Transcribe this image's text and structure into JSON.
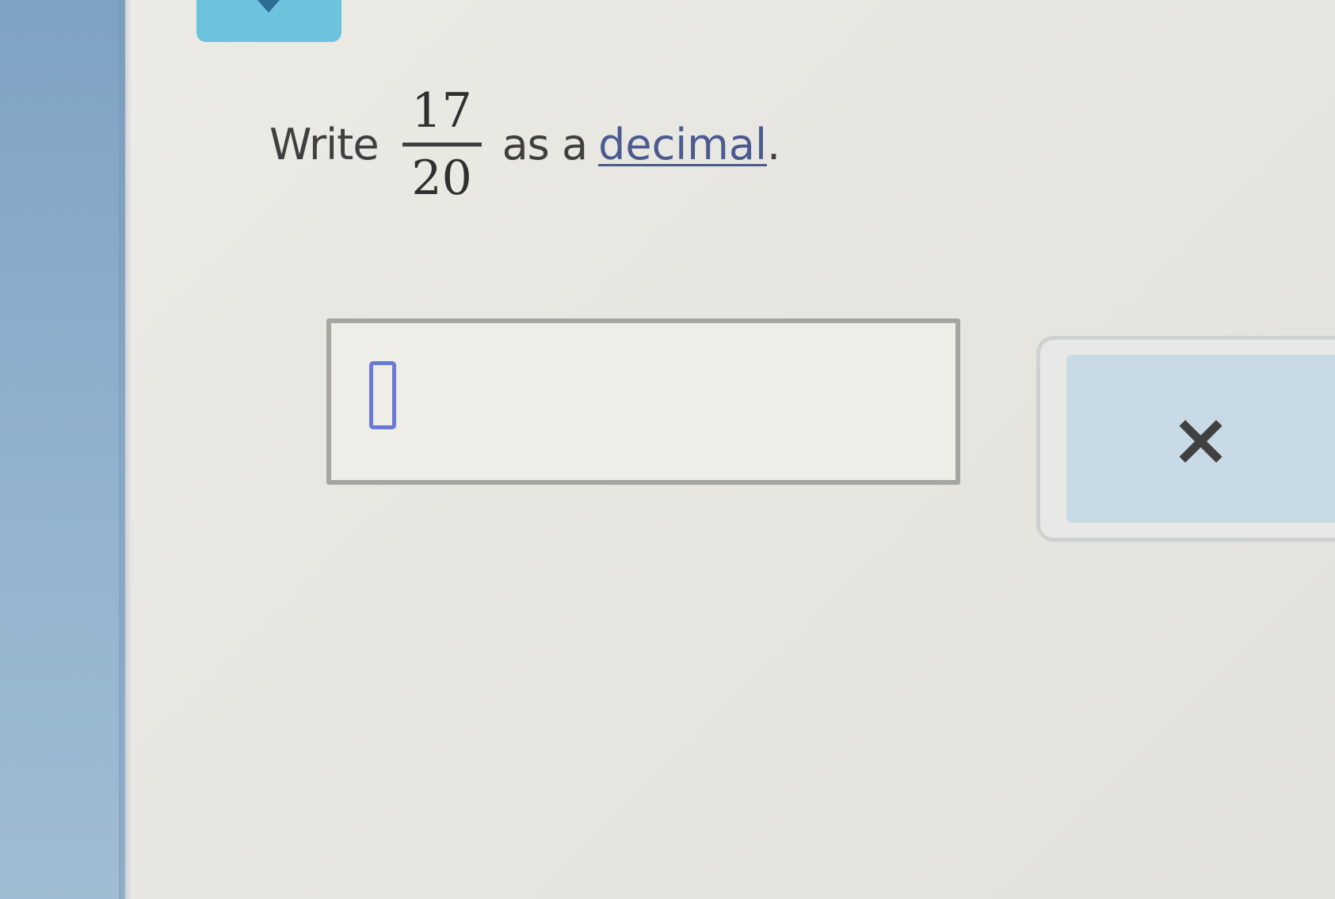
{
  "question": {
    "prefix": "Write",
    "fraction": {
      "numerator": "17",
      "denominator": "20"
    },
    "middle": "as a",
    "link_text": "decimal",
    "suffix": "."
  },
  "answer": {
    "value": ""
  },
  "controls": {
    "clear_symbol": "×"
  },
  "icons": {
    "top_button_icon": "chevron-down-icon",
    "answer_cursor": "text-cursor-icon"
  },
  "colors": {
    "link": "#4b5b8f",
    "cursor": "#6a78da",
    "clear_button": "#c8dae5",
    "top_button": "#6cc3db"
  }
}
